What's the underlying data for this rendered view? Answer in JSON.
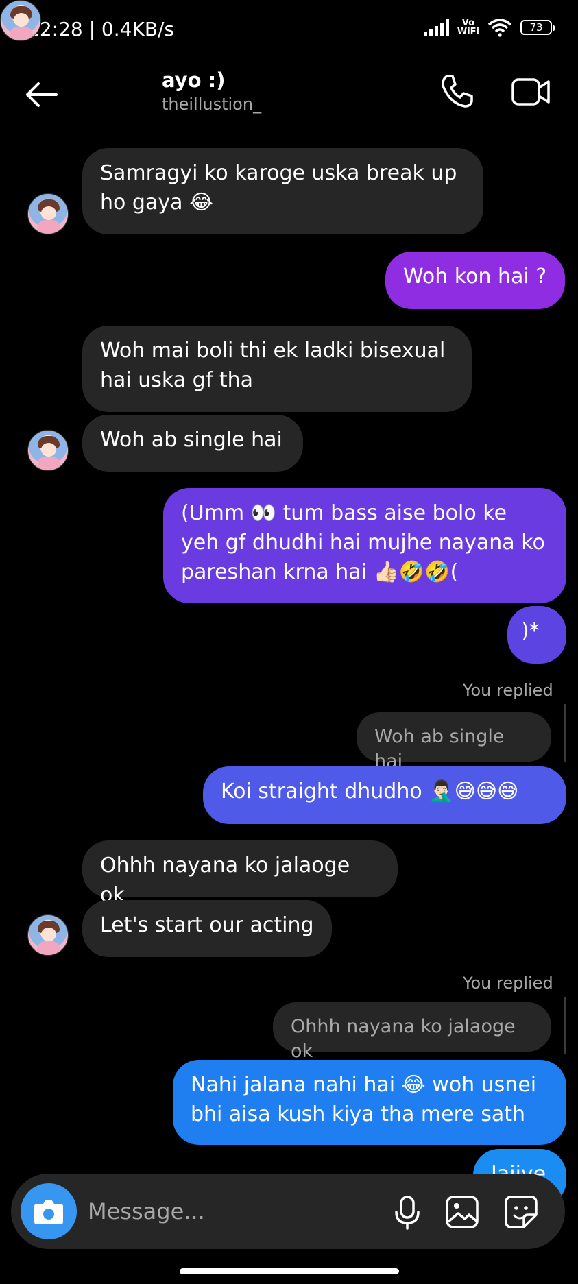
{
  "status_bar": {
    "time": "12:28 | 0.4KB/s",
    "vowifi_top": "Vo",
    "vowifi_bottom": "WiFi",
    "battery": "73"
  },
  "header": {
    "name": "ayo :)",
    "username": "theillustion_"
  },
  "messages": [
    {
      "text": "Samragyi ko karoge uska break up ho gaya 😂"
    },
    {
      "text": "Woh kon hai ?"
    },
    {
      "text": "Woh mai boli thi ek ladki bisexual hai uska gf tha"
    },
    {
      "text": "Woh ab single hai"
    },
    {
      "text": "(Umm 👀  tum bass aise bolo ke yeh gf dhudhi hai mujhe nayana ko pareshan krna hai 👍🏻🤣🤣("
    },
    {
      "text": ")*"
    },
    {
      "text": "Koi straight dhudho 🤦🏻‍♂️😅😅😅"
    },
    {
      "text": "Ohhh nayana ko jalaoge ok"
    },
    {
      "text": "Let's start our acting"
    },
    {
      "text": "Nahi jalana nahi hai 😂 woh usnei bhi aisa kush kiya tha mere sath"
    },
    {
      "text": "Jaiiye"
    }
  ],
  "replies": [
    {
      "label": "You replied",
      "quote": "Woh ab single hai"
    },
    {
      "label": "You replied",
      "quote": "Ohhh nayana ko jalaoge ok"
    }
  ],
  "composer": {
    "placeholder": "Message..."
  },
  "colors": {
    "incoming": "#262626",
    "purple": "#8e2de2",
    "violet": "#6a3be0",
    "indigo": "#4f5ae8",
    "blue": "#1f7ef0"
  }
}
